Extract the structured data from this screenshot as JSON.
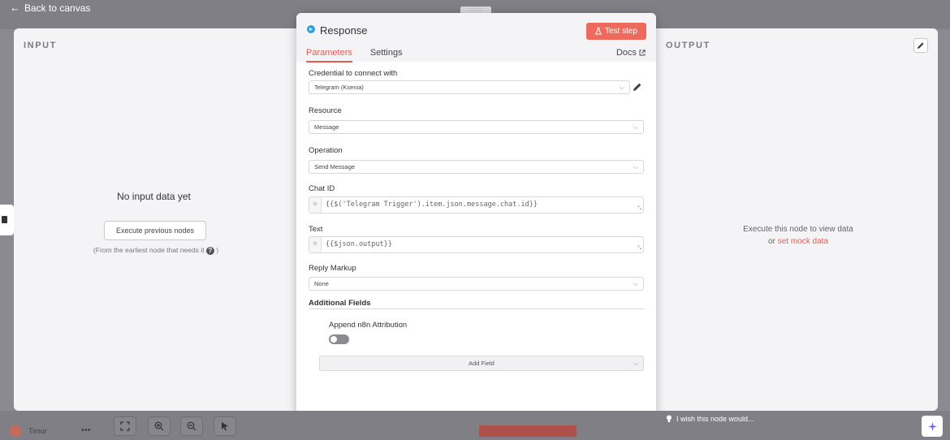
{
  "nav": {
    "back_label": "Back to canvas"
  },
  "input_panel": {
    "title": "INPUT",
    "empty_title": "No input data yet",
    "execute_button": "Execute previous nodes",
    "hint": "(From the earliest node that needs it",
    "hint_end": ")"
  },
  "output_panel": {
    "title": "OUTPUT",
    "message_line1": "Execute this node to view data",
    "message_prefix": "or ",
    "mock_link": "set mock data"
  },
  "node": {
    "title": "Response",
    "test_step_label": "Test step",
    "tabs": [
      {
        "label": "Parameters",
        "active": true
      },
      {
        "label": "Settings",
        "active": false
      }
    ],
    "docs_label": "Docs"
  },
  "params": {
    "credential_label": "Credential to connect with",
    "credential_value": "Telegram (Ksenia)",
    "resource_label": "Resource",
    "resource_value": "Message",
    "operation_label": "Operation",
    "operation_value": "Send Message",
    "chat_id_label": "Chat ID",
    "chat_id_value": "{{$('Telegram Trigger').item.json.message.chat.id}}",
    "text_label": "Text",
    "text_value": "{{$json.output}}",
    "reply_markup_label": "Reply Markup",
    "reply_markup_value": "None",
    "additional_fields_label": "Additional Fields",
    "attribution_label": "Append n8n Attribution",
    "attribution_enabled": false,
    "add_field_label": "Add Field"
  },
  "footer": {
    "user_name": "Timur",
    "menu": "•••",
    "wish_label": "I wish this node would..."
  },
  "colors": {
    "accent": "#ea5a4e",
    "telegram": "#2aa3de"
  }
}
